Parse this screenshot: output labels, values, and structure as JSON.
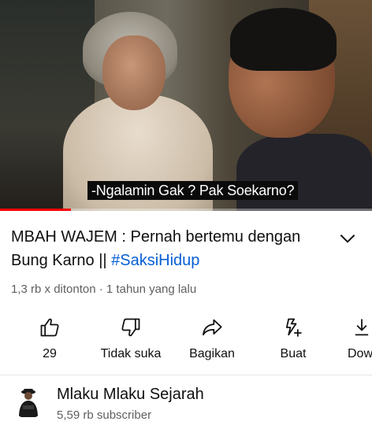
{
  "video": {
    "caption": "-Ngalamin Gak ? Pak Soekarno?",
    "progress_fraction": 0.19,
    "progress_color": "#ff0000"
  },
  "title": {
    "text": "MBAH WAJEM : Pernah bertemu dengan Bung Karno || ",
    "hashtag": "#SaksiHidup",
    "hashtag_color": "#065fd4",
    "expand_icon": "chevron-down-icon"
  },
  "meta": {
    "views": "1,3 rb x ditonton",
    "separator": " · ",
    "age": "1 tahun yang lalu"
  },
  "actions": [
    {
      "id": "like",
      "icon": "thumbs-up-icon",
      "label": "29"
    },
    {
      "id": "dislike",
      "icon": "thumbs-down-icon",
      "label": "Tidak suka"
    },
    {
      "id": "share",
      "icon": "share-icon",
      "label": "Bagikan"
    },
    {
      "id": "create",
      "icon": "create-icon",
      "label": "Buat"
    },
    {
      "id": "download",
      "icon": "download-icon",
      "label": "Dow"
    }
  ],
  "channel": {
    "name": "Mlaku Mlaku Sejarah",
    "subscribers": "5,59 rb subscriber",
    "avatar_icon": "channel-avatar"
  }
}
